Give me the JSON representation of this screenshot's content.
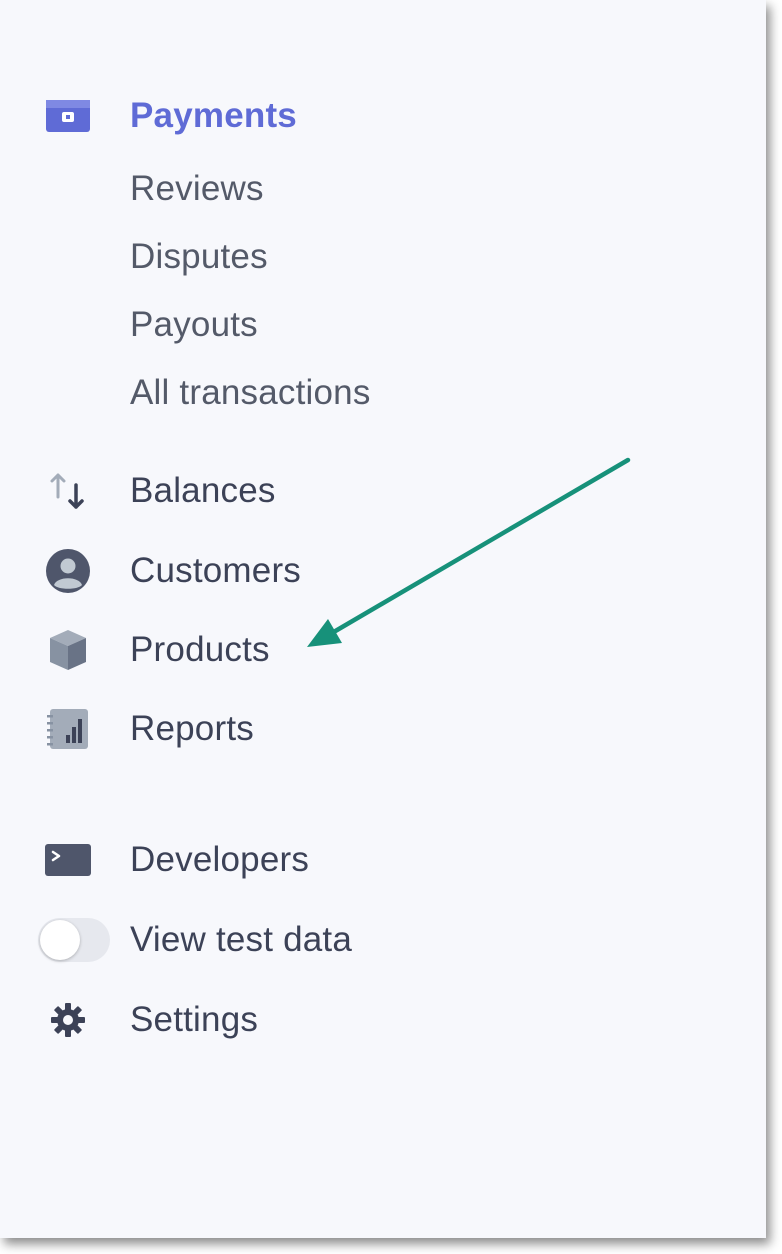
{
  "sidebar": {
    "payments": {
      "label": "Payments",
      "icon": "wallet-icon",
      "active": true
    },
    "payments_sub": [
      {
        "label": "Reviews"
      },
      {
        "label": "Disputes"
      },
      {
        "label": "Payouts"
      },
      {
        "label": "All transactions"
      }
    ],
    "main_items": [
      {
        "label": "Balances",
        "icon": "balance-arrows-icon"
      },
      {
        "label": "Customers",
        "icon": "person-icon"
      },
      {
        "label": "Products",
        "icon": "box-icon"
      },
      {
        "label": "Reports",
        "icon": "report-chart-icon"
      }
    ],
    "developers": {
      "label": "Developers",
      "icon": "terminal-icon"
    },
    "view_test_data": {
      "label": "View test data",
      "toggle_on": false
    },
    "settings": {
      "label": "Settings",
      "icon": "gear-icon"
    }
  },
  "annotation": {
    "arrow_color": "#17917a",
    "points_to": "Products"
  },
  "colors": {
    "active": "#5f6bd6",
    "text": "#3c4257",
    "icon": "#6b7a90",
    "background": "#f7f8fc"
  }
}
